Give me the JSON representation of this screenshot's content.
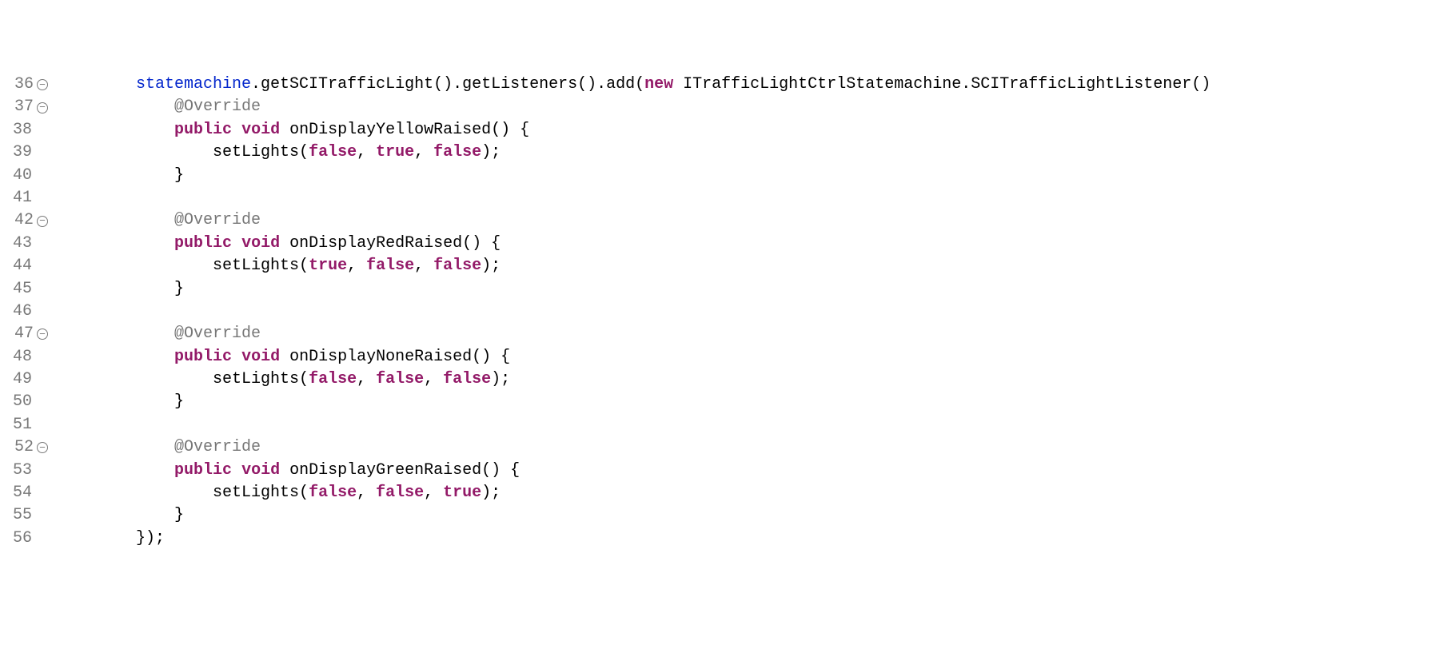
{
  "lines": [
    {
      "n": "36",
      "fold": true,
      "segs": [
        {
          "cls": "txt",
          "t": "        "
        },
        {
          "cls": "fld",
          "t": "statemachine"
        },
        {
          "cls": "txt",
          "t": ".getSCITrafficLight().getListeners().add("
        },
        {
          "cls": "kw",
          "t": "new"
        },
        {
          "cls": "txt",
          "t": " ITrafficLightCtrlStatemachine.SCITrafficLightListener()"
        }
      ]
    },
    {
      "n": "37",
      "fold": true,
      "segs": [
        {
          "cls": "txt",
          "t": "            "
        },
        {
          "cls": "ann",
          "t": "@Override"
        }
      ]
    },
    {
      "n": "38",
      "fold": false,
      "segs": [
        {
          "cls": "txt",
          "t": "            "
        },
        {
          "cls": "kw",
          "t": "public"
        },
        {
          "cls": "txt",
          "t": " "
        },
        {
          "cls": "kw",
          "t": "void"
        },
        {
          "cls": "txt",
          "t": " onDisplayYellowRaised() {"
        }
      ]
    },
    {
      "n": "39",
      "fold": false,
      "segs": [
        {
          "cls": "txt",
          "t": "                setLights("
        },
        {
          "cls": "kw2",
          "t": "false"
        },
        {
          "cls": "txt",
          "t": ", "
        },
        {
          "cls": "kw2",
          "t": "true"
        },
        {
          "cls": "txt",
          "t": ", "
        },
        {
          "cls": "kw2",
          "t": "false"
        },
        {
          "cls": "txt",
          "t": ");"
        }
      ]
    },
    {
      "n": "40",
      "fold": false,
      "segs": [
        {
          "cls": "txt",
          "t": "            }"
        }
      ]
    },
    {
      "n": "41",
      "fold": false,
      "segs": [
        {
          "cls": "txt",
          "t": ""
        }
      ]
    },
    {
      "n": "42",
      "fold": true,
      "segs": [
        {
          "cls": "txt",
          "t": "            "
        },
        {
          "cls": "ann",
          "t": "@Override"
        }
      ]
    },
    {
      "n": "43",
      "fold": false,
      "segs": [
        {
          "cls": "txt",
          "t": "            "
        },
        {
          "cls": "kw",
          "t": "public"
        },
        {
          "cls": "txt",
          "t": " "
        },
        {
          "cls": "kw",
          "t": "void"
        },
        {
          "cls": "txt",
          "t": " onDisplayRedRaised() {"
        }
      ]
    },
    {
      "n": "44",
      "fold": false,
      "segs": [
        {
          "cls": "txt",
          "t": "                setLights("
        },
        {
          "cls": "kw2",
          "t": "true"
        },
        {
          "cls": "txt",
          "t": ", "
        },
        {
          "cls": "kw2",
          "t": "false"
        },
        {
          "cls": "txt",
          "t": ", "
        },
        {
          "cls": "kw2",
          "t": "false"
        },
        {
          "cls": "txt",
          "t": ");"
        }
      ]
    },
    {
      "n": "45",
      "fold": false,
      "segs": [
        {
          "cls": "txt",
          "t": "            }"
        }
      ]
    },
    {
      "n": "46",
      "fold": false,
      "segs": [
        {
          "cls": "txt",
          "t": ""
        }
      ]
    },
    {
      "n": "47",
      "fold": true,
      "segs": [
        {
          "cls": "txt",
          "t": "            "
        },
        {
          "cls": "ann",
          "t": "@Override"
        }
      ]
    },
    {
      "n": "48",
      "fold": false,
      "segs": [
        {
          "cls": "txt",
          "t": "            "
        },
        {
          "cls": "kw",
          "t": "public"
        },
        {
          "cls": "txt",
          "t": " "
        },
        {
          "cls": "kw",
          "t": "void"
        },
        {
          "cls": "txt",
          "t": " onDisplayNoneRaised() {"
        }
      ]
    },
    {
      "n": "49",
      "fold": false,
      "segs": [
        {
          "cls": "txt",
          "t": "                setLights("
        },
        {
          "cls": "kw2",
          "t": "false"
        },
        {
          "cls": "txt",
          "t": ", "
        },
        {
          "cls": "kw2",
          "t": "false"
        },
        {
          "cls": "txt",
          "t": ", "
        },
        {
          "cls": "kw2",
          "t": "false"
        },
        {
          "cls": "txt",
          "t": ");"
        }
      ]
    },
    {
      "n": "50",
      "fold": false,
      "segs": [
        {
          "cls": "txt",
          "t": "            }"
        }
      ]
    },
    {
      "n": "51",
      "fold": false,
      "segs": [
        {
          "cls": "txt",
          "t": ""
        }
      ]
    },
    {
      "n": "52",
      "fold": true,
      "segs": [
        {
          "cls": "txt",
          "t": "            "
        },
        {
          "cls": "ann",
          "t": "@Override"
        }
      ]
    },
    {
      "n": "53",
      "fold": false,
      "segs": [
        {
          "cls": "txt",
          "t": "            "
        },
        {
          "cls": "kw",
          "t": "public"
        },
        {
          "cls": "txt",
          "t": " "
        },
        {
          "cls": "kw",
          "t": "void"
        },
        {
          "cls": "txt",
          "t": " onDisplayGreenRaised() {"
        }
      ]
    },
    {
      "n": "54",
      "fold": false,
      "segs": [
        {
          "cls": "txt",
          "t": "                setLights("
        },
        {
          "cls": "kw2",
          "t": "false"
        },
        {
          "cls": "txt",
          "t": ", "
        },
        {
          "cls": "kw2",
          "t": "false"
        },
        {
          "cls": "txt",
          "t": ", "
        },
        {
          "cls": "kw2",
          "t": "true"
        },
        {
          "cls": "txt",
          "t": ");"
        }
      ]
    },
    {
      "n": "55",
      "fold": false,
      "segs": [
        {
          "cls": "txt",
          "t": "            }"
        }
      ]
    },
    {
      "n": "56",
      "fold": false,
      "segs": [
        {
          "cls": "txt",
          "t": "        });"
        }
      ]
    }
  ],
  "fold_glyph": "⊖"
}
